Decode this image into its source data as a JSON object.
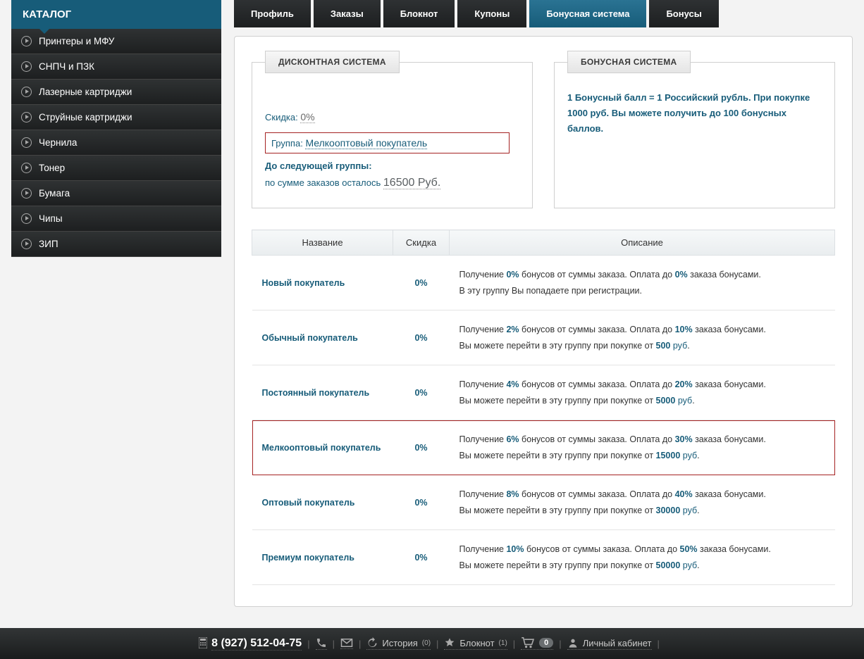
{
  "sidebar": {
    "title": "КАТАЛОГ",
    "items": [
      {
        "label": "Принтеры и МФУ"
      },
      {
        "label": "СНПЧ и ПЗК"
      },
      {
        "label": "Лазерные картриджи"
      },
      {
        "label": "Струйные картриджи"
      },
      {
        "label": "Чернила"
      },
      {
        "label": "Тонер"
      },
      {
        "label": "Бумага"
      },
      {
        "label": "Чипы"
      },
      {
        "label": "ЗИП"
      }
    ]
  },
  "tabs": [
    {
      "label": "Профиль",
      "active": false
    },
    {
      "label": "Заказы",
      "active": false
    },
    {
      "label": "Блокнот",
      "active": false
    },
    {
      "label": "Купоны",
      "active": false
    },
    {
      "label": "Бонусная система",
      "active": true
    },
    {
      "label": "Бонусы",
      "active": false
    }
  ],
  "discount": {
    "legend": "ДИСКОНТНАЯ СИСТЕМА",
    "skidka_label": "Скидка:",
    "skidka_value": "0%",
    "group_label": "Группа:",
    "group_value": "Мелкооптовый покупатель",
    "next_label": "До следующей группы:",
    "next_text_prefix": "по сумме заказов осталось",
    "next_amount": "16500 Руб."
  },
  "bonus": {
    "legend": "БОНУСНАЯ СИСТЕМА",
    "text": "1 Бонусный балл = 1 Российский рубль. При покупке 1000 руб. Вы можете получить до 100 бонусных баллов."
  },
  "table": {
    "headers": {
      "name": "Название",
      "discount": "Скидка",
      "desc": "Описание"
    },
    "rows": [
      {
        "name": "Новый покупатель",
        "discount": "0%",
        "bonus": "0%",
        "pay": "0%",
        "line2_type": "reg",
        "line2_text": "В эту группу Вы попадаете при регистрации.",
        "current": false
      },
      {
        "name": "Обычный покупатель",
        "discount": "0%",
        "bonus": "2%",
        "pay": "10%",
        "line2_type": "buy",
        "line2_value": "500",
        "current": false
      },
      {
        "name": "Постоянный покупатель",
        "discount": "0%",
        "bonus": "4%",
        "pay": "20%",
        "line2_type": "buy",
        "line2_value": "5000",
        "current": false
      },
      {
        "name": "Мелкооптовый покупатель",
        "discount": "0%",
        "bonus": "6%",
        "pay": "30%",
        "line2_type": "buy",
        "line2_value": "15000",
        "current": true
      },
      {
        "name": "Оптовый покупатель",
        "discount": "0%",
        "bonus": "8%",
        "pay": "40%",
        "line2_type": "buy",
        "line2_value": "30000",
        "current": false
      },
      {
        "name": "Премиум покупатель",
        "discount": "0%",
        "bonus": "10%",
        "pay": "50%",
        "line2_type": "buy",
        "line2_value": "50000",
        "current": false
      }
    ],
    "labels": {
      "desc_t1a": "Получение ",
      "desc_t1b": " бонусов от суммы заказа. Оплата до ",
      "desc_t1c": " заказа бонусами.",
      "buy_prefix": "Вы можете перейти в эту группу при покупке от ",
      "rub": " руб"
    }
  },
  "footer": {
    "phone": "8 (927) 512-04-75",
    "history_label": "История",
    "history_count": "(0)",
    "notepad_label": "Блокнот",
    "notepad_count": "(1)",
    "cart_count": "0",
    "account_label": "Личный кабинет"
  }
}
